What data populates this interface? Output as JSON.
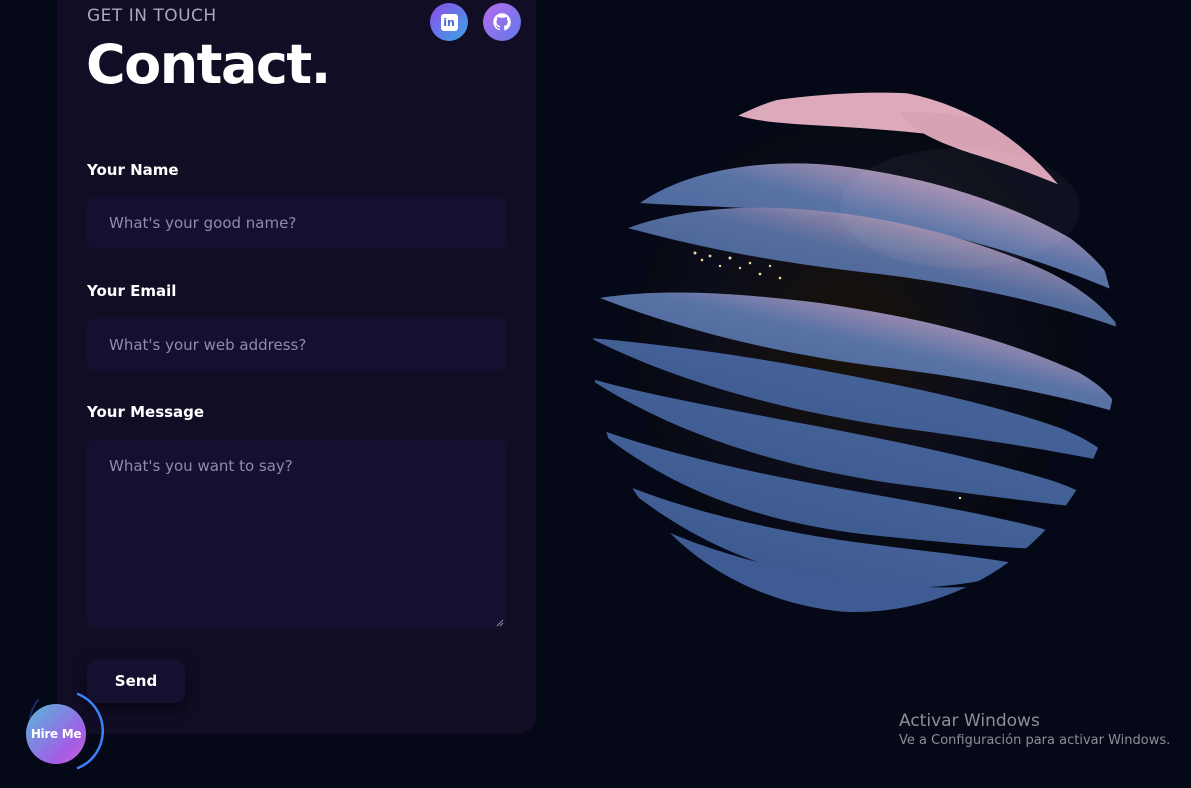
{
  "header": {
    "subtitle": "GET IN TOUCH",
    "title": "Contact."
  },
  "social": {
    "linkedin_icon": "linkedin-icon",
    "linkedin_text": "in",
    "github_icon": "github-icon"
  },
  "form": {
    "name_label": "Your Name",
    "name_placeholder": "What's your good name?",
    "email_label": "Your Email",
    "email_placeholder": "What's your web address?",
    "message_label": "Your Message",
    "message_placeholder": "What's you want to say?",
    "send_label": "Send"
  },
  "hire_button": {
    "label": "Hire Me"
  },
  "watermark": {
    "title": "Activar Windows",
    "subtitle": "Ve a Configuración para activar Windows."
  },
  "colors": {
    "background": "#050816",
    "card": "#100d25",
    "input": "#151030",
    "secondary_text": "#aaa6c3",
    "globe_band_blue": "#3f5c93",
    "globe_band_pink": "#d8a6b6"
  }
}
